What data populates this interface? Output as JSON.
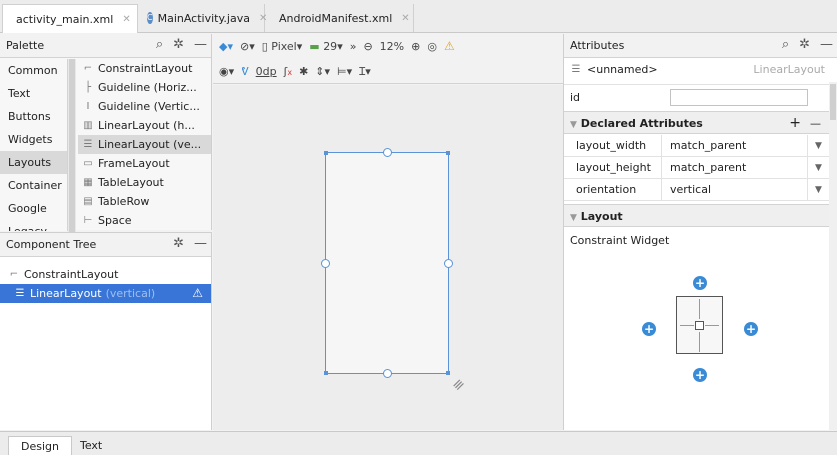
{
  "tabs": [
    {
      "label": "activity_main.xml",
      "icon": "xml-file-icon"
    },
    {
      "label": "MainActivity.java",
      "icon": "java-class-icon"
    },
    {
      "label": "AndroidManifest.xml",
      "icon": "manifest-file-icon"
    }
  ],
  "palette": {
    "title": "Palette",
    "categories": [
      "Common",
      "Text",
      "Buttons",
      "Widgets",
      "Layouts",
      "Container",
      "Google",
      "Legacy"
    ],
    "selected_category": "Layouts",
    "items": [
      {
        "label": "ConstraintLayout",
        "icon": "constraint-layout-icon"
      },
      {
        "label": "Guideline (Horiz...",
        "icon": "guideline-horizontal-icon"
      },
      {
        "label": "Guideline (Vertic...",
        "icon": "guideline-vertical-icon"
      },
      {
        "label": "LinearLayout (h...",
        "icon": "linear-layout-horizontal-icon"
      },
      {
        "label": "LinearLayout (ve...",
        "icon": "linear-layout-vertical-icon"
      },
      {
        "label": "FrameLayout",
        "icon": "frame-layout-icon"
      },
      {
        "label": "TableLayout",
        "icon": "table-layout-icon"
      },
      {
        "label": "TableRow",
        "icon": "table-row-icon"
      },
      {
        "label": "Space",
        "icon": "space-icon"
      }
    ]
  },
  "toolbar": {
    "device": "Pixel",
    "api": "29",
    "zoom": "12%",
    "margin": "0dp"
  },
  "component_tree": {
    "title": "Component Tree",
    "root": "ConstraintLayout",
    "child": "LinearLayout",
    "child_suffix": "(vertical)"
  },
  "attributes": {
    "title": "Attributes",
    "widget_name": "<unnamed>",
    "widget_type": "LinearLayout",
    "id_label": "id",
    "id_value": "",
    "declared_title": "Declared Attributes",
    "declared": [
      {
        "key": "layout_width",
        "value": "match_parent"
      },
      {
        "key": "layout_height",
        "value": "match_parent"
      },
      {
        "key": "orientation",
        "value": "vertical"
      }
    ],
    "layout_title": "Layout",
    "constraint_widget": "Constraint Widget"
  },
  "bottom_tabs": [
    "Design",
    "Text"
  ]
}
